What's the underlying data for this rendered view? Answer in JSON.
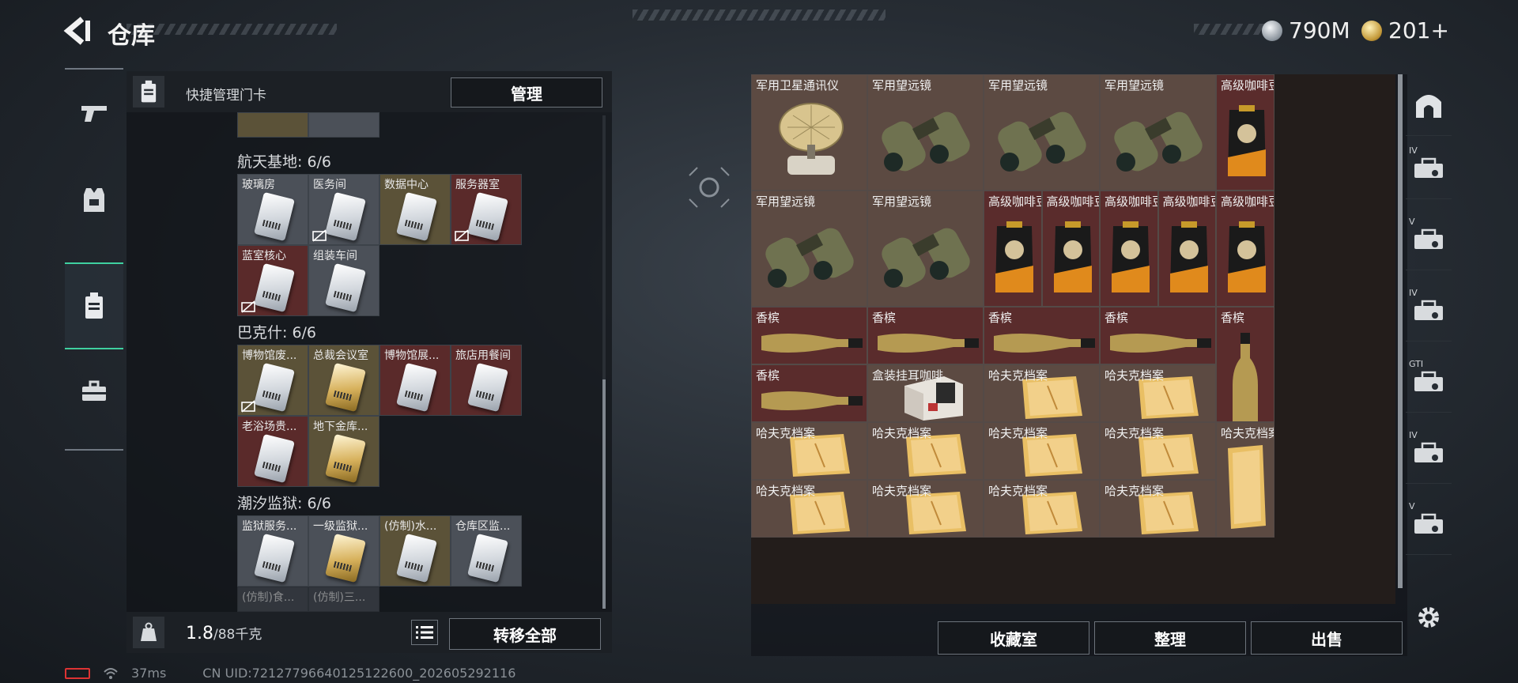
{
  "header": {
    "title": "仓库",
    "currency_silver": "790M",
    "currency_gold": "201+"
  },
  "left_panel": {
    "header_label": "快捷管理门卡",
    "manage_button": "管理",
    "sections": [
      {
        "title": "航天基地: 6/6",
        "cards": [
          "玻璃房",
          "医务间",
          "数据中心",
          "服务器室",
          "蓝室核心",
          "组装车间"
        ]
      },
      {
        "title": "巴克什: 6/6",
        "cards": [
          "博物馆废...",
          "总裁会议室",
          "博物馆展...",
          "旅店用餐间",
          "老浴场贵...",
          "地下金库..."
        ]
      },
      {
        "title": "潮汐监狱: 6/6",
        "cards": [
          "监狱服务...",
          "一级监狱...",
          "(仿制)水...",
          "仓库区监...",
          "(仿制)食...",
          "(仿制)三..."
        ]
      }
    ],
    "weight": "1.8",
    "weight_max": "/88千克",
    "transfer_button": "转移全部"
  },
  "status": {
    "ping": "37ms",
    "uid": "CN UID:7212779664012512​2600_202605292116"
  },
  "items": [
    "军用卫星通讯仪",
    "军用望远镜",
    "军用望远镜",
    "军用望远镜",
    "高级咖啡豆",
    "军用望远镜",
    "军用望远镜",
    "高级咖啡豆",
    "高级咖啡豆",
    "高级咖啡豆",
    "高级咖啡豆",
    "高级咖啡豆",
    "香槟",
    "香槟",
    "香槟",
    "香槟",
    "香槟",
    "香槟",
    "盒装挂耳咖啡",
    "哈夫克档案",
    "哈夫克档案",
    "哈夫克档案",
    "哈夫克档案",
    "哈夫克档案",
    "哈夫克档案",
    "哈夫克档案",
    "哈夫克档案",
    "哈夫克档案",
    "哈夫克档案",
    "哈夫克档案"
  ],
  "right_footer": {
    "collection_button": "收藏室",
    "sort_button": "整理",
    "sell_button": "出售"
  },
  "right_nav_labels": [
    "IV",
    "V",
    "IV",
    "GTI",
    "IV",
    "V"
  ],
  "colors": {
    "accent": "#3fd0a0",
    "slot_red": "#5a2c2c",
    "slot_brown": "#5c4a42"
  }
}
